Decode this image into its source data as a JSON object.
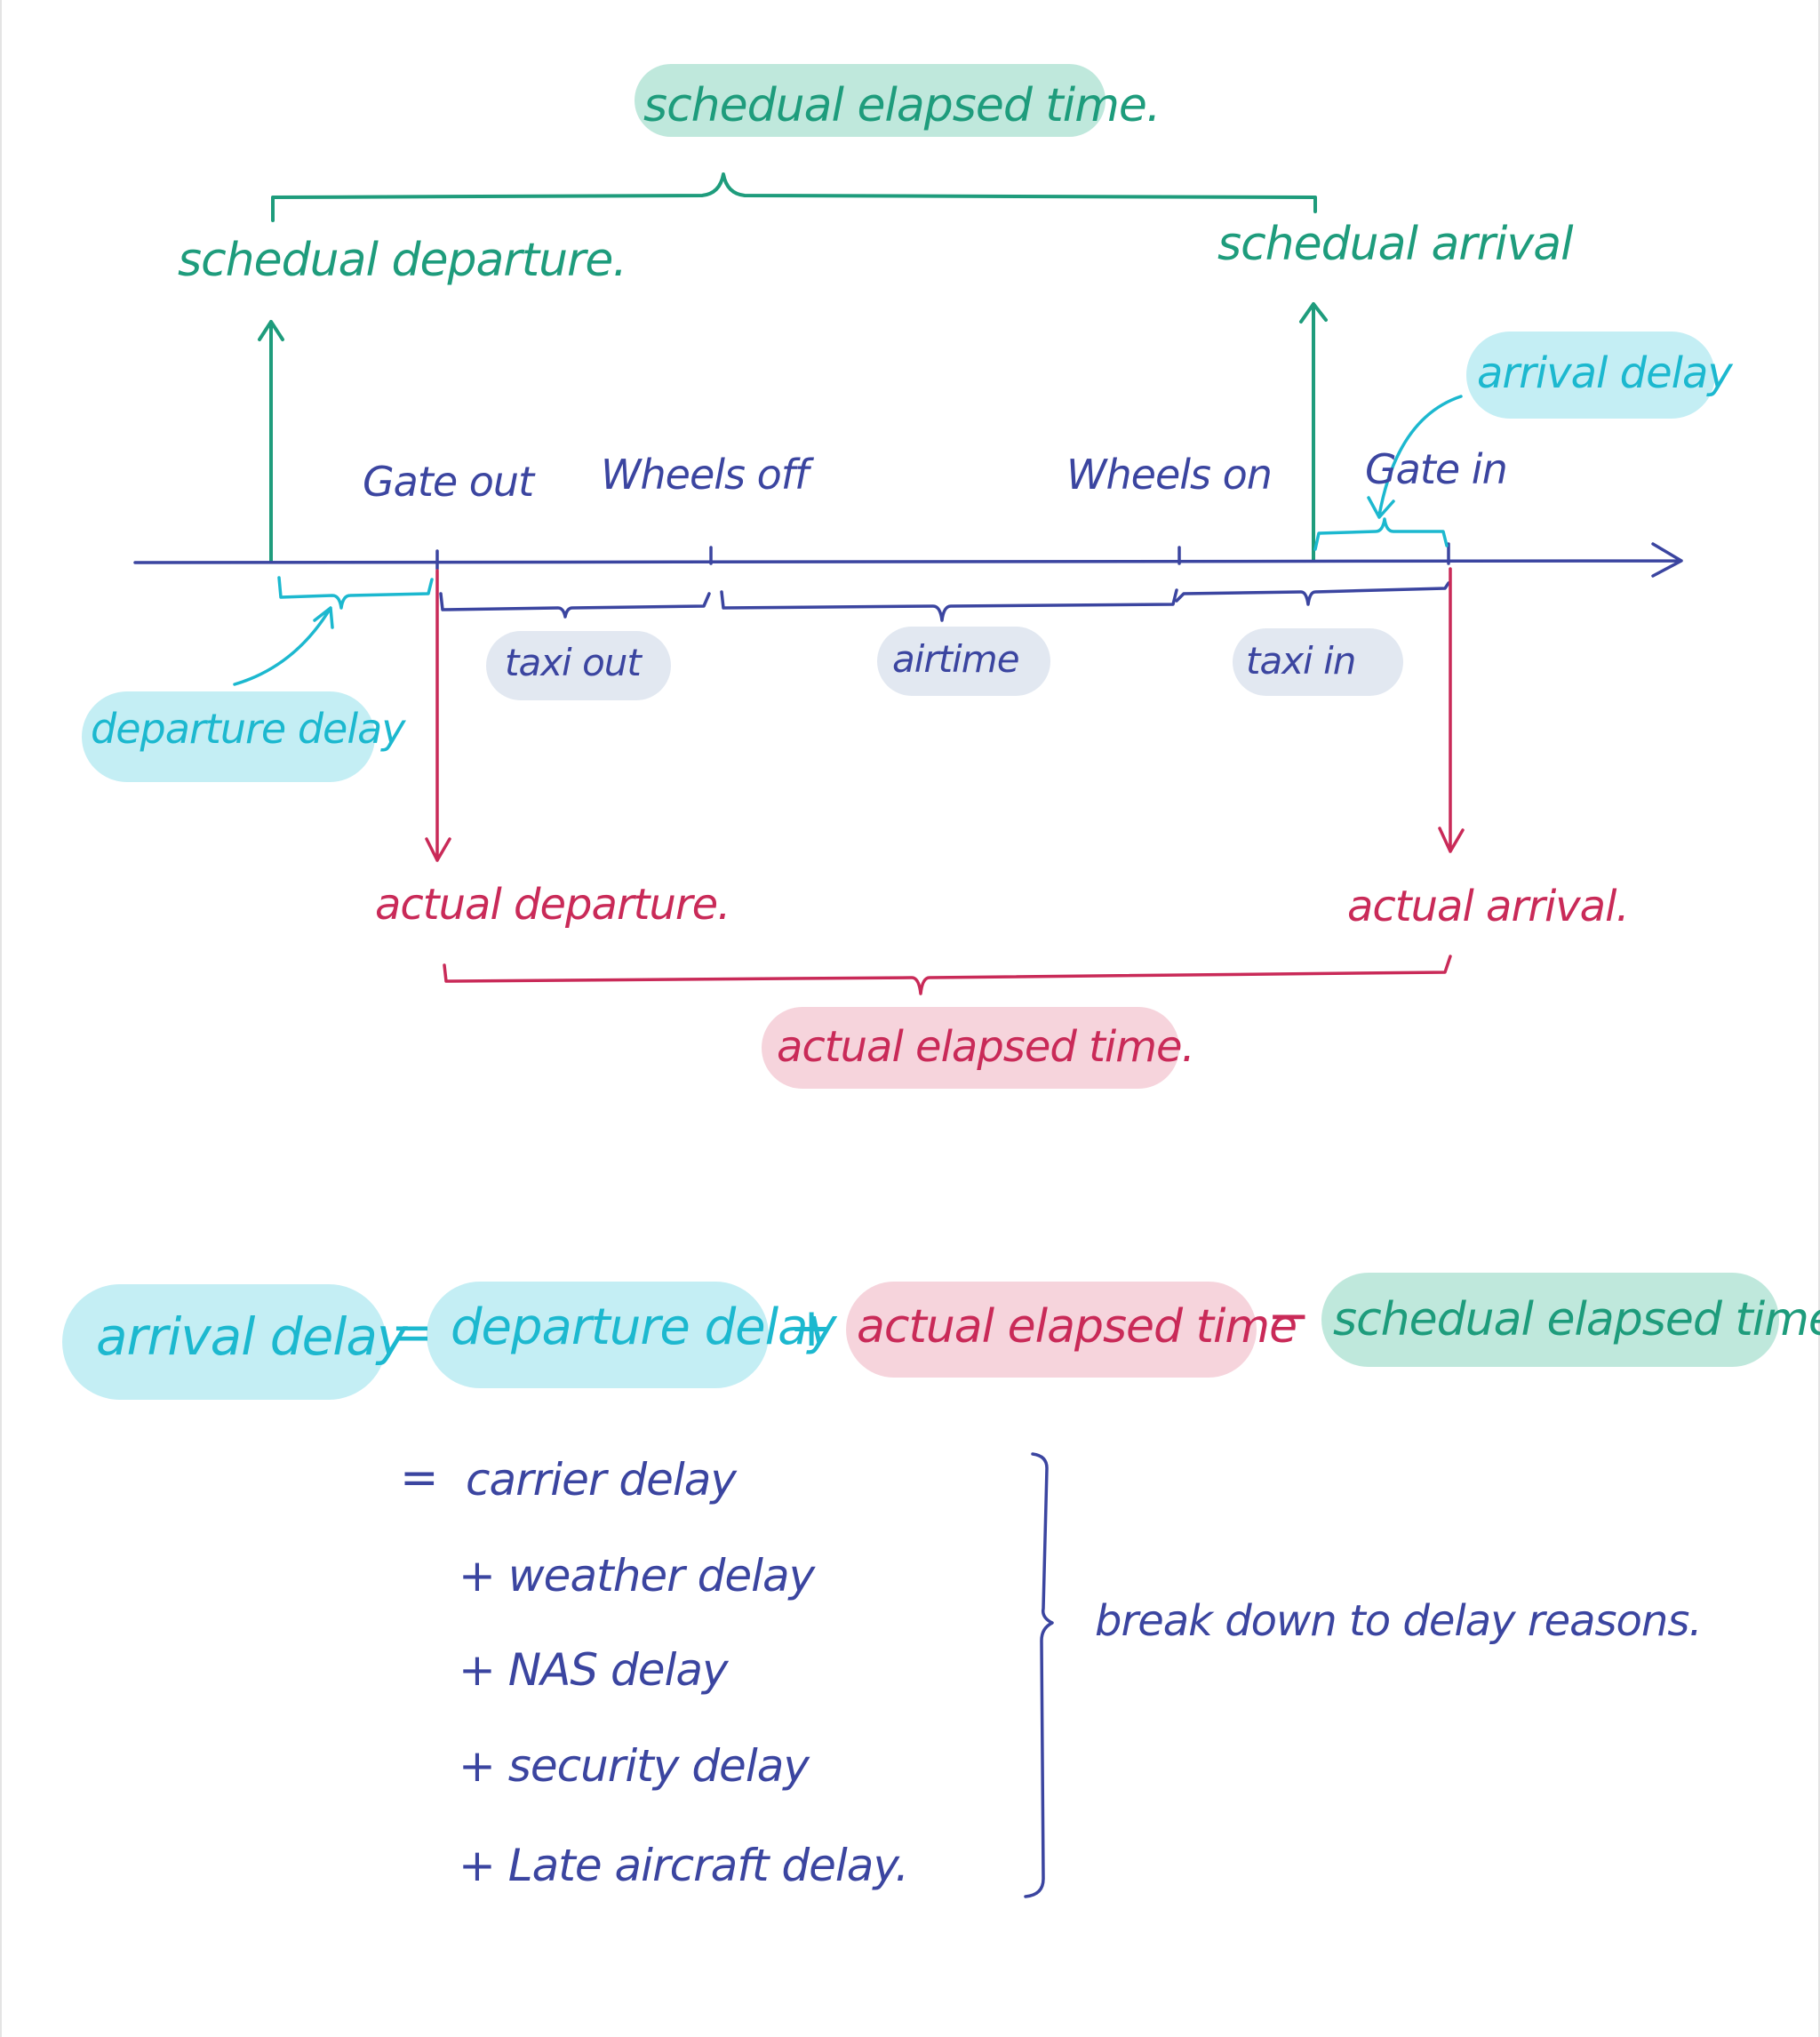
{
  "colors": {
    "green": "#1e9c7c",
    "green_hl": "#bfe8dc",
    "cyan": "#1cb8cf",
    "cyan_hl": "#c4eef4",
    "blue": "#3b45a0",
    "blue_hl": "#e2e8f1",
    "red": "#c92a58",
    "red_hl": "#f6d4dc"
  },
  "timeline": {
    "scheduled_elapsed_time": "schedual elapsed time.",
    "scheduled_departure": "schedual departure.",
    "scheduled_arrival": "schedual arrival",
    "arrival_delay": "arrival delay",
    "departure_delay": "departure delay",
    "gate_out": "Gate out",
    "wheels_off": "Wheels off",
    "wheels_on": "Wheels on",
    "gate_in": "Gate in",
    "taxi_out": "taxi out",
    "airtime": "airtime",
    "taxi_in": "taxi in",
    "actual_departure": "actual departure.",
    "actual_arrival": "actual arrival.",
    "actual_elapsed_time": "actual elapsed time."
  },
  "equation": {
    "lhs": "arrival delay",
    "equals": "=",
    "term1": "departure delay",
    "plus": "+",
    "term2": "actual elapsed time",
    "minus": "−",
    "term3": "schedual elapsed time."
  },
  "breakdown": {
    "equals": "=",
    "items": [
      "carrier delay",
      "+ weather delay",
      "+ NAS delay",
      "+ security delay",
      "+ Late aircraft delay."
    ],
    "note": "break down to delay reasons."
  }
}
